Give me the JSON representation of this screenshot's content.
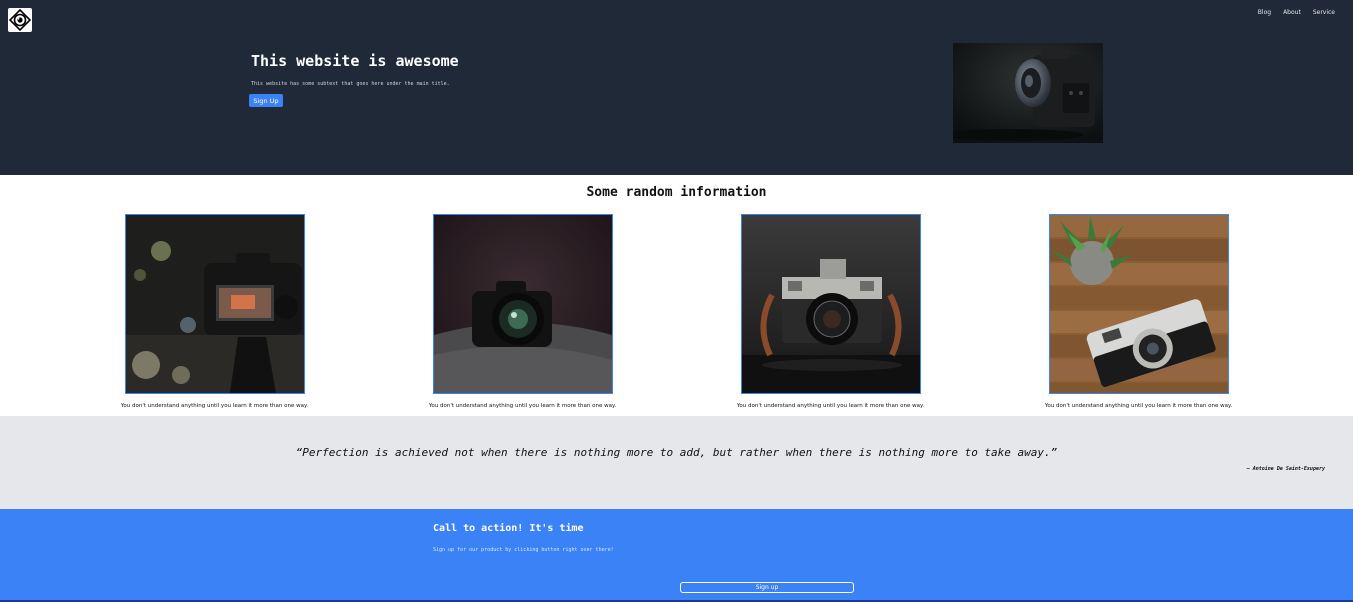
{
  "header": {
    "logo_icon": "camera-lens-logo-icon",
    "nav": [
      {
        "label": "Blog"
      },
      {
        "label": "About"
      },
      {
        "label": "Service"
      }
    ]
  },
  "hero": {
    "title": "This website is awesome",
    "subtitle": "This website has some subtext that goes here under the main title.",
    "button_label": "Sign Up",
    "image": "camera-photo"
  },
  "info": {
    "title": "Some random information",
    "cards": [
      {
        "image": "camera-lcd-bokeh-photo",
        "caption": "You don't understand anything until you learn it more than one way."
      },
      {
        "image": "camera-lens-front-photo",
        "caption": "You don't understand anything until you learn it more than one way."
      },
      {
        "image": "vintage-camera-photo",
        "caption": "You don't understand anything until you learn it more than one way."
      },
      {
        "image": "camera-on-wood-photo",
        "caption": "You don't understand anything until you learn it more than one way."
      }
    ]
  },
  "quote": {
    "text": "“Perfection is achieved not when there is nothing more to add, but rather when there is nothing more to take away.”",
    "author": "– Antoine De Saint-Exupery"
  },
  "cta": {
    "title": "Call to action! It's time",
    "subtitle": "Sign up for our product by clicking button right over there!",
    "button_label": "Sign up"
  },
  "colors": {
    "hero_bg": "#1f2937",
    "accent": "#3b82f6",
    "quote_bg": "#e5e7eb"
  }
}
